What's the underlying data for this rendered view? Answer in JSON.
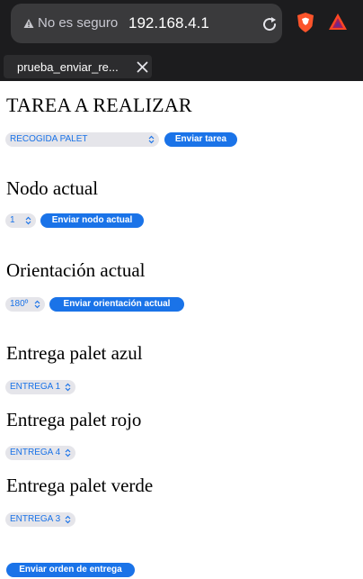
{
  "browser": {
    "security_text": "No es seguro",
    "host": "192.168.4.1",
    "tab_title": "prueba_enviar_re..."
  },
  "task": {
    "heading": "TAREA A REALIZAR",
    "selected": "RECOGIDA PALET",
    "button": "Enviar tarea"
  },
  "node": {
    "heading": "Nodo actual",
    "selected": "1",
    "button": "Enviar nodo actual"
  },
  "orientation": {
    "heading": "Orientación actual",
    "selected": "180º",
    "button": "Enviar orientación actual"
  },
  "blue": {
    "heading": "Entrega palet azul",
    "selected": "ENTREGA 1"
  },
  "red": {
    "heading": "Entrega palet rojo",
    "selected": "ENTREGA 4"
  },
  "green": {
    "heading": "Entrega palet verde",
    "selected": "ENTREGA 3"
  },
  "submit": {
    "button": "Enviar orden de entrega"
  },
  "colors": {
    "accent": "#1a73e8",
    "chrome_bg": "#1c1c1e"
  }
}
